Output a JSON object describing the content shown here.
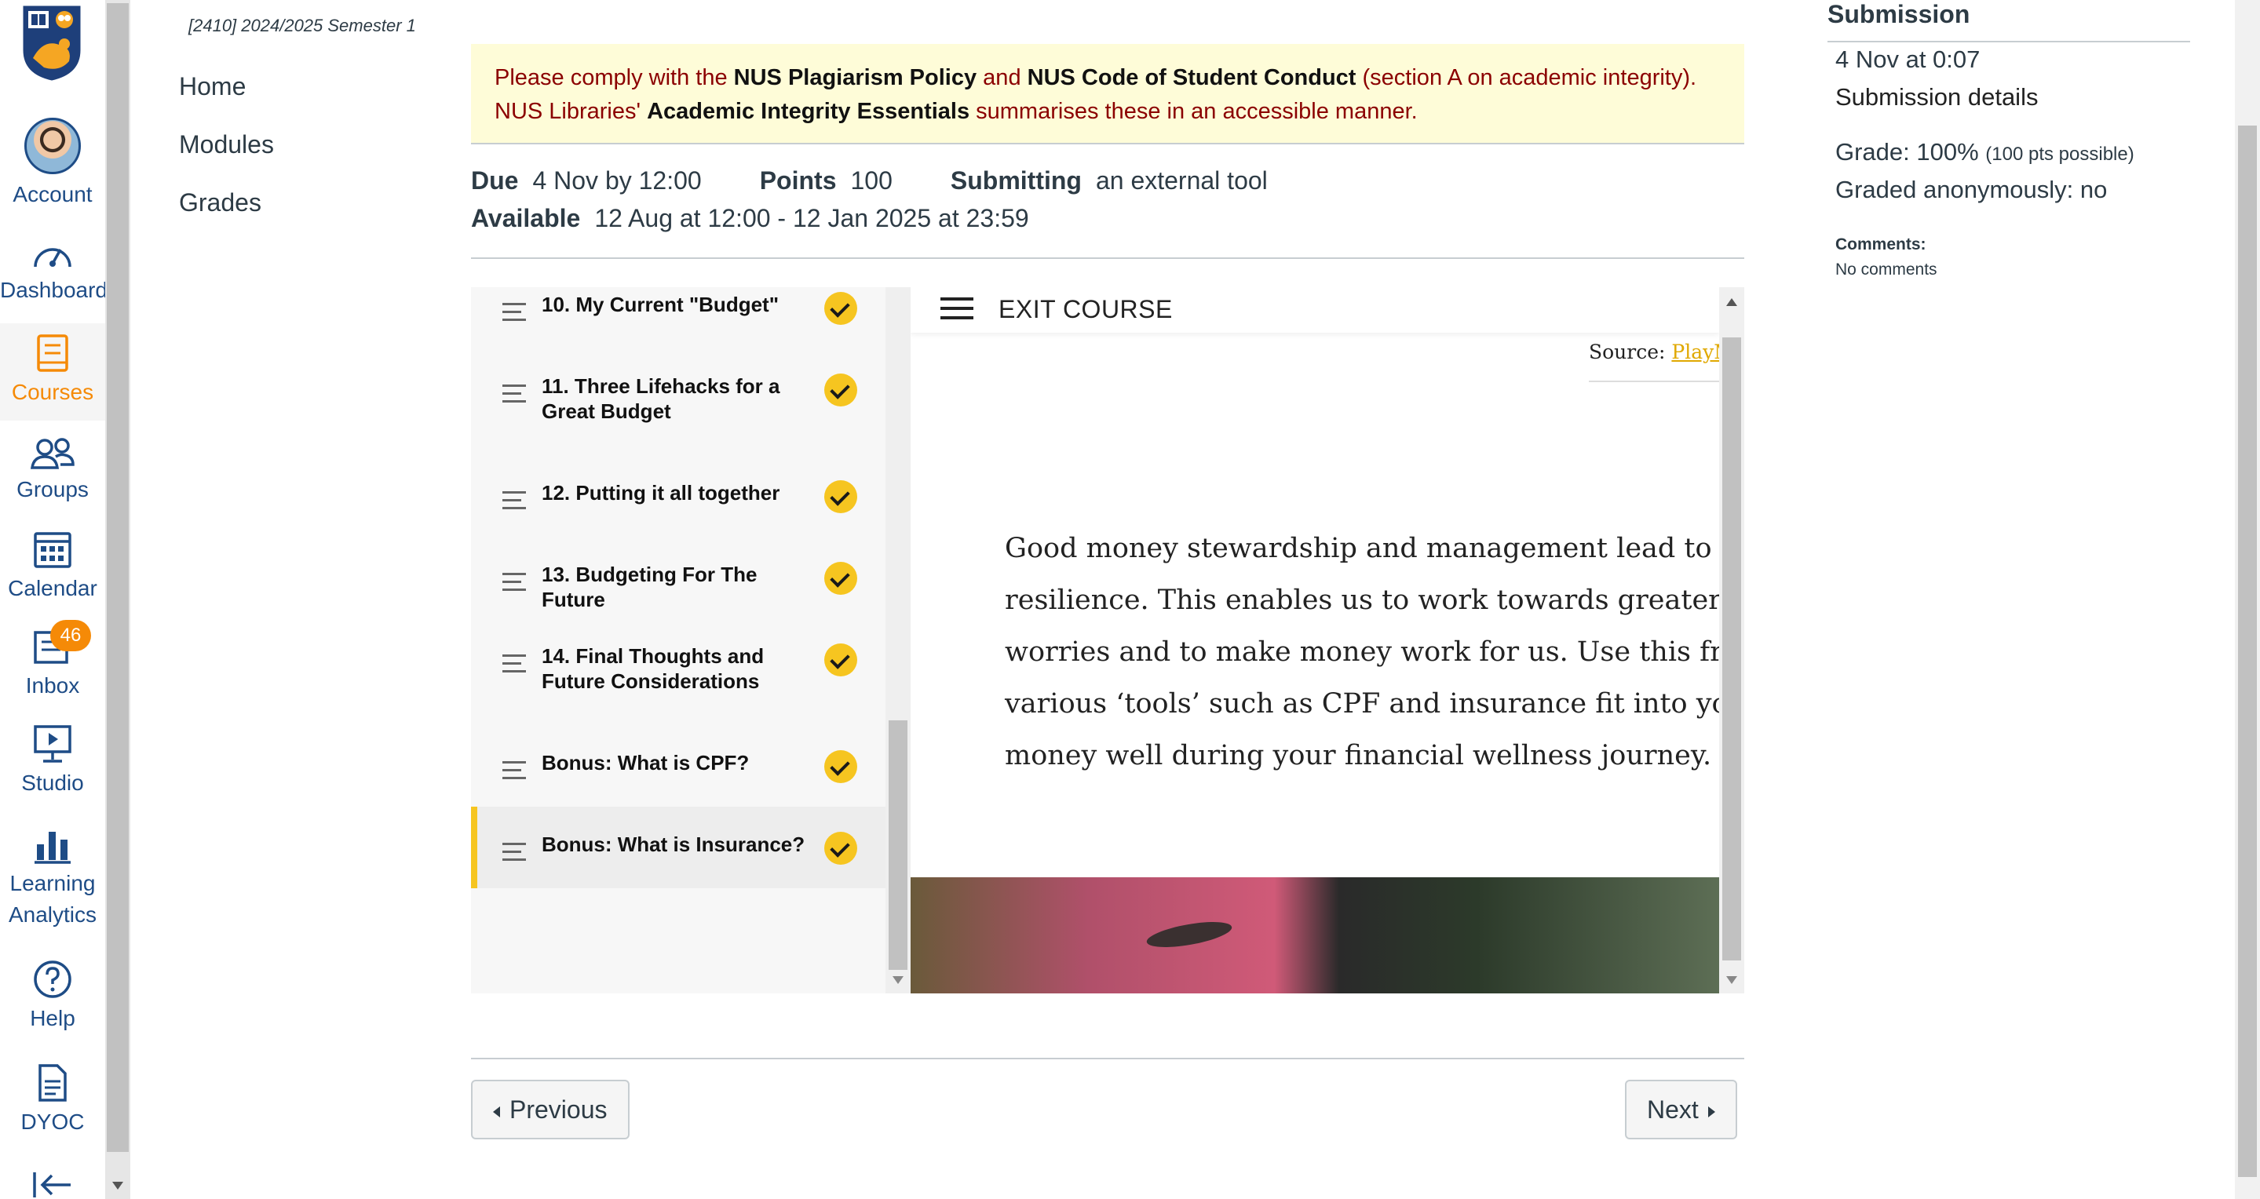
{
  "global_nav": {
    "account": "Account",
    "dashboard": "Dashboard",
    "courses": "Courses",
    "groups": "Groups",
    "calendar": "Calendar",
    "inbox": "Inbox",
    "inbox_badge": "46",
    "studio": "Studio",
    "learning_analytics_1": "Learning",
    "learning_analytics_2": "Analytics",
    "help": "Help",
    "dyoc": "DYOC",
    "accent_color": "#f58a07",
    "icon_color": "#1e4c86"
  },
  "course_nav": {
    "term": "[2410] 2024/2025 Semester 1",
    "items": [
      "Home",
      "Modules",
      "Grades"
    ]
  },
  "notice": {
    "p1": "Please comply with the ",
    "b1": "NUS Plagiarism Policy",
    "p2": " and ",
    "b2": "NUS Code of Student Conduct",
    "p3": " (section A on academic integrity). NUS Libraries' ",
    "b3": "Academic Integrity Essentials",
    "p4": " summarises these in an accessible manner."
  },
  "assignment": {
    "due_label": "Due",
    "due_value": "4 Nov by 12:00",
    "points_label": "Points",
    "points_value": "100",
    "submitting_label": "Submitting",
    "submitting_value": "an external tool",
    "available_label": "Available",
    "available_value": "12 Aug at 12:00 - 12 Jan 2025 at 23:59"
  },
  "lessons": [
    {
      "title": "10. My Current \"Budget\""
    },
    {
      "title": "11. Three Lifehacks for a Great Budget"
    },
    {
      "title": "12. Putting it all together"
    },
    {
      "title": "13. Budgeting For The Future"
    },
    {
      "title": "14. Final Thoughts and Future Considerations"
    },
    {
      "title": "Bonus: What is CPF?"
    },
    {
      "title": "Bonus: What is Insurance?"
    }
  ],
  "content": {
    "exit_label": "EXIT COURSE",
    "source_label": "Source: ",
    "source_link": "PlayM",
    "lines": [
      "Good money stewardship and management lead to fina",
      "resilience. This enables us to work towards greater free",
      "worries and to make money work for us. Use this frame",
      "various ‘tools’ such as CPF and insurance fit into your",
      "money well during your financial wellness journey."
    ]
  },
  "pagination": {
    "previous": "Previous",
    "next": "Next"
  },
  "submission": {
    "title": "Submission",
    "date": "4 Nov at 0:07",
    "details": "Submission details",
    "grade": "Grade: 100%",
    "grade_possible": "(100 pts possible)",
    "anonymous": "Graded anonymously: no",
    "comments_label": "Comments:",
    "comments_value": "No comments"
  }
}
